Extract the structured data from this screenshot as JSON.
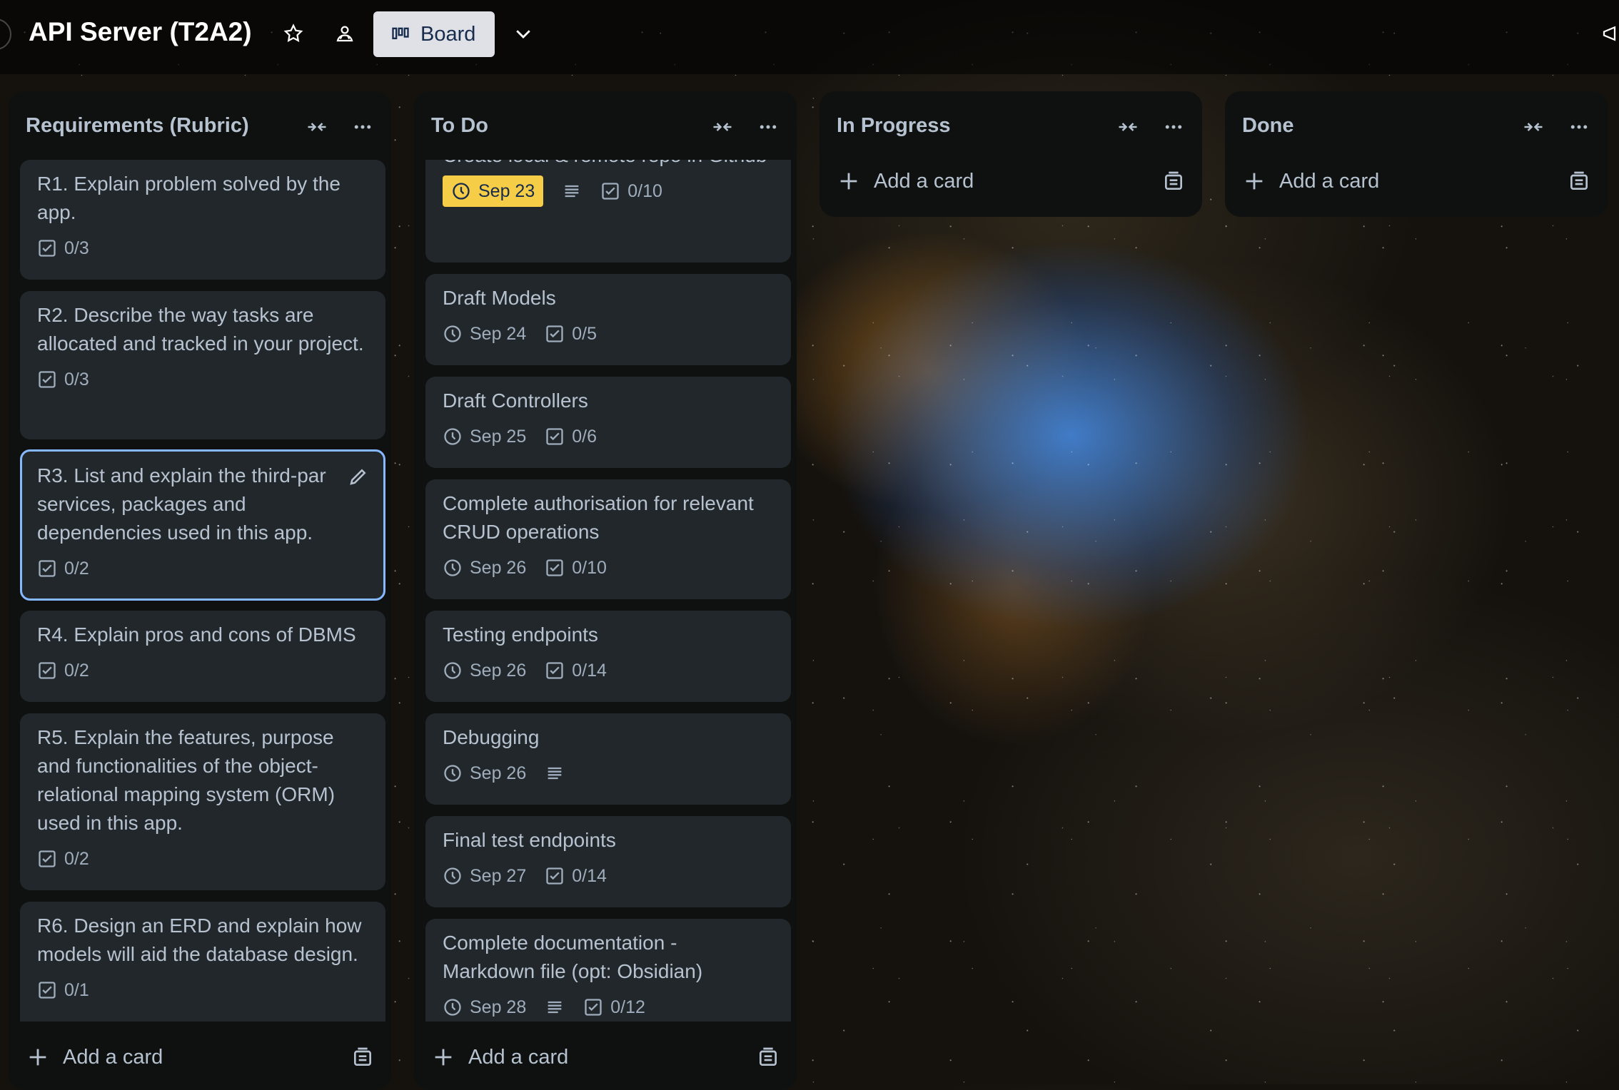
{
  "header": {
    "board_title": "API Server (T2A2)",
    "view_label": "Board",
    "icons": [
      "star-icon",
      "visibility-icon",
      "board-view-icon",
      "chevron-down-icon",
      "megaphone-icon"
    ]
  },
  "colors": {
    "due_soon": "#f5cd47",
    "focus_ring": "#85b8ff",
    "card_bg": "#22272b",
    "list_bg": "#0f1110"
  },
  "lists": [
    {
      "title": "Requirements (Rubric)",
      "add_card_label": "Add a card",
      "cards": [
        {
          "title": "R1. Explain problem solved by the app.",
          "checklist": "0/3"
        },
        {
          "title": "R2. Describe the way tasks are allocated and tracked in your project.",
          "checklist": "0/3"
        },
        {
          "title": "R3. List and explain the third-par services, packages and dependencies used in this app.",
          "checklist": "0/2"
        },
        {
          "title": "R4. Explain pros and cons of DBMS",
          "checklist": "0/2"
        },
        {
          "title": "R5. Explain the features, purpose and functionalities of the object-relational mapping system (ORM) used in this app.",
          "checklist": "0/2"
        },
        {
          "title": "R6. Design an ERD and explain how models will aid the database design.",
          "checklist": "0/1"
        }
      ]
    },
    {
      "title": "To Do",
      "add_card_label": "Add a card",
      "cards": [
        {
          "title": "Create local & remote repo in Github",
          "due": "Sep 23",
          "checklist": "0/10"
        },
        {
          "title": "Draft Models",
          "due": "Sep 24",
          "checklist": "0/5"
        },
        {
          "title": "Draft Controllers",
          "due": "Sep 25",
          "checklist": "0/6"
        },
        {
          "title": "Complete authorisation for relevant CRUD operations",
          "due": "Sep 26",
          "checklist": "0/10"
        },
        {
          "title": "Testing endpoints",
          "due": "Sep 26",
          "checklist": "0/14"
        },
        {
          "title": "Debugging",
          "due": "Sep 26"
        },
        {
          "title": "Final test endpoints",
          "due": "Sep 27",
          "checklist": "0/14"
        },
        {
          "title": "Complete documentation - Markdown file (opt: Obsidian)",
          "due": "Sep 28",
          "checklist": "0/12"
        }
      ]
    },
    {
      "title": "In Progress",
      "add_card_label": "Add a card"
    },
    {
      "title": "Done",
      "add_card_label": "Add a card"
    }
  ]
}
